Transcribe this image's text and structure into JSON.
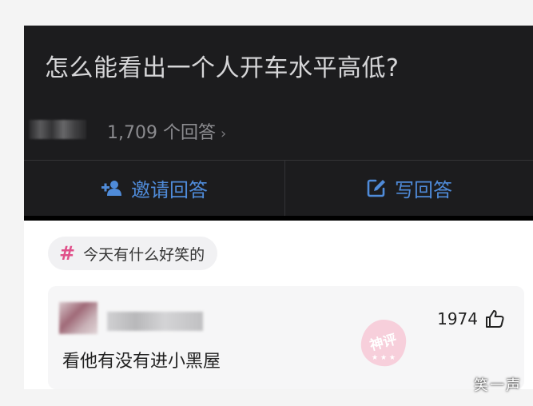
{
  "question": {
    "title": "怎么能看出一个人开车水平高低?",
    "answer_count": "1,709 个回答",
    "chevron": "›"
  },
  "actions": {
    "invite_label": "邀请回答",
    "write_label": "写回答",
    "accent_color": "#4f8bd9"
  },
  "topic": {
    "hash_symbol": "#",
    "label": "今天有什么好笑的",
    "hash_color": "#e0508a"
  },
  "comment": {
    "likes": "1974",
    "text": "看他有没有进小黑屋",
    "stamp_text": "神评"
  },
  "watermark": "笑一声"
}
